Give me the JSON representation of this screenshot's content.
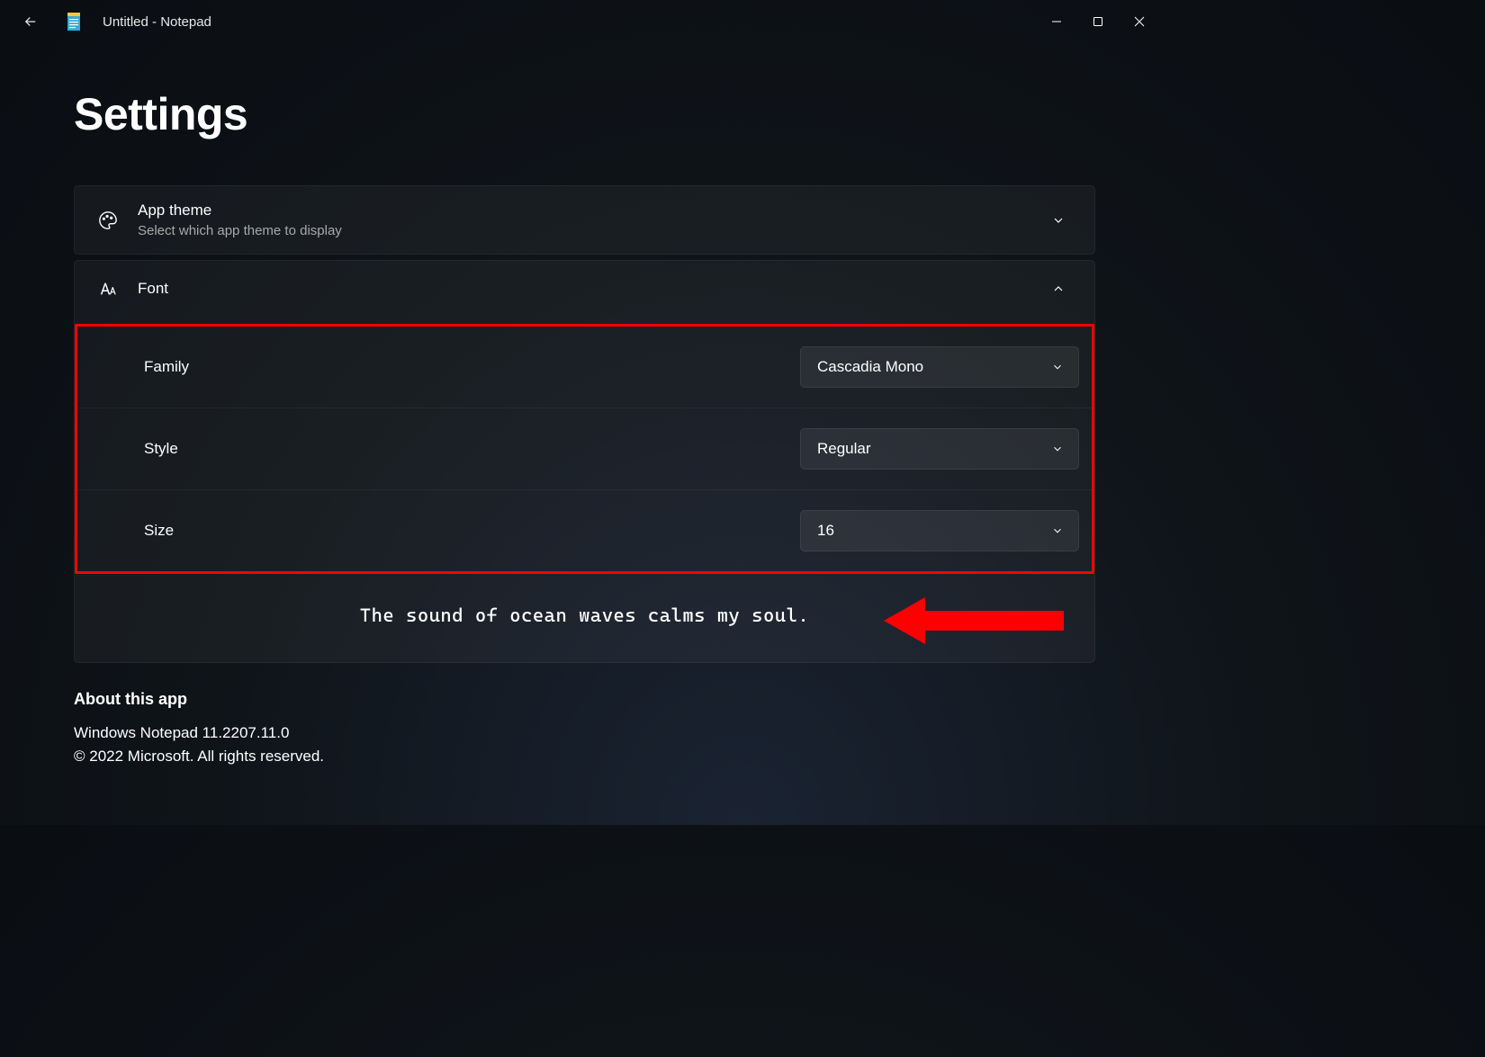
{
  "window": {
    "title": "Untitled - Notepad"
  },
  "page": {
    "heading": "Settings"
  },
  "appTheme": {
    "title": "App theme",
    "subtitle": "Select which app theme to display"
  },
  "font": {
    "title": "Font",
    "rows": {
      "family": {
        "label": "Family",
        "value": "Cascadia Mono"
      },
      "style": {
        "label": "Style",
        "value": "Regular"
      },
      "size": {
        "label": "Size",
        "value": "16"
      }
    },
    "preview": "The sound of ocean waves calms my soul."
  },
  "about": {
    "heading": "About this app",
    "version": "Windows Notepad 11.2207.11.0",
    "copyright": "© 2022 Microsoft. All rights reserved."
  }
}
